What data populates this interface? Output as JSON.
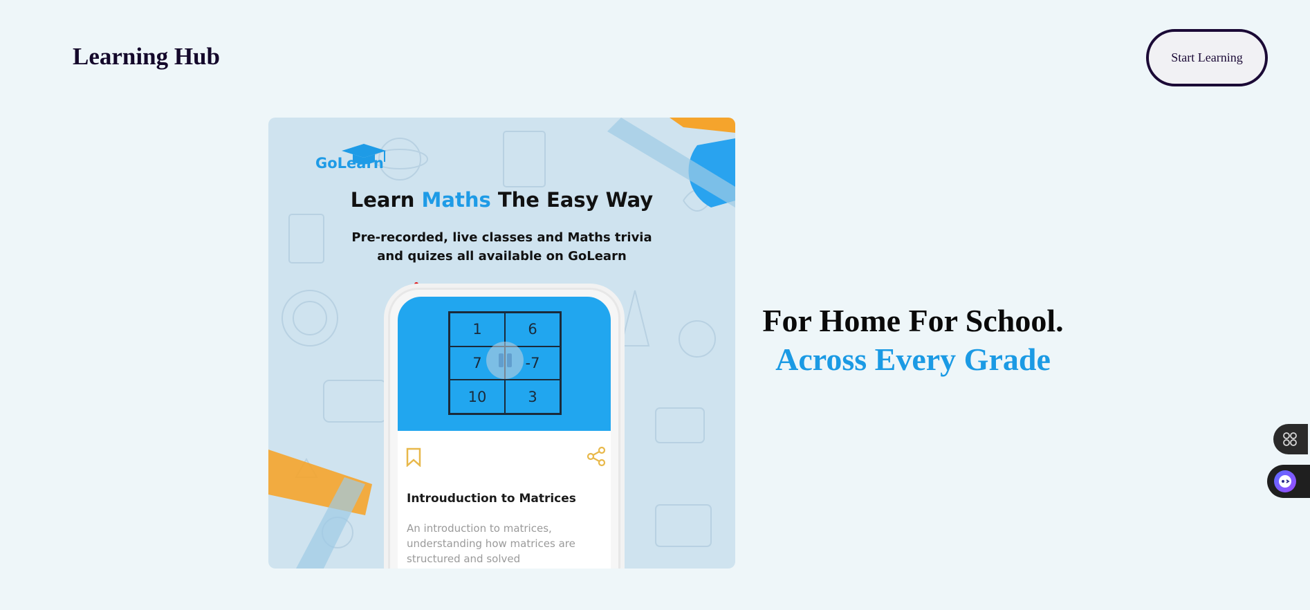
{
  "header": {
    "brand": "Learning Hub",
    "cta_label": "Start Learning"
  },
  "hero": {
    "logo_text": "GoLearn",
    "title_part1": "Learn ",
    "title_accent": "Maths",
    "title_part2": " The Easy Way",
    "subtitle": "Pre-recorded, live classes and Maths trivia and quizes all available on GoLearn",
    "grid_values": [
      "1",
      "6",
      "7",
      "-7",
      "10",
      "3"
    ],
    "card_title": "Introuduction to Matrices",
    "card_description": "An introduction to matrices, understanding how matrices are structured and solved"
  },
  "tagline": {
    "line1": "For Home For School.",
    "line2": "Across Every Grade"
  },
  "icons": {
    "apps": "apps-grid-icon",
    "extension": "extension-face-icon",
    "bookmark": "bookmark-icon",
    "share": "share-icon",
    "pause": "pause-icon",
    "graduation_cap": "graduation-cap-icon"
  },
  "colors": {
    "background": "#eef6f9",
    "brand_dark": "#14082b",
    "accent_blue": "#1b9ae4",
    "screen_blue": "#21a6ef",
    "hero_bg": "#cfe3ef",
    "orange": "#f5a42c"
  }
}
